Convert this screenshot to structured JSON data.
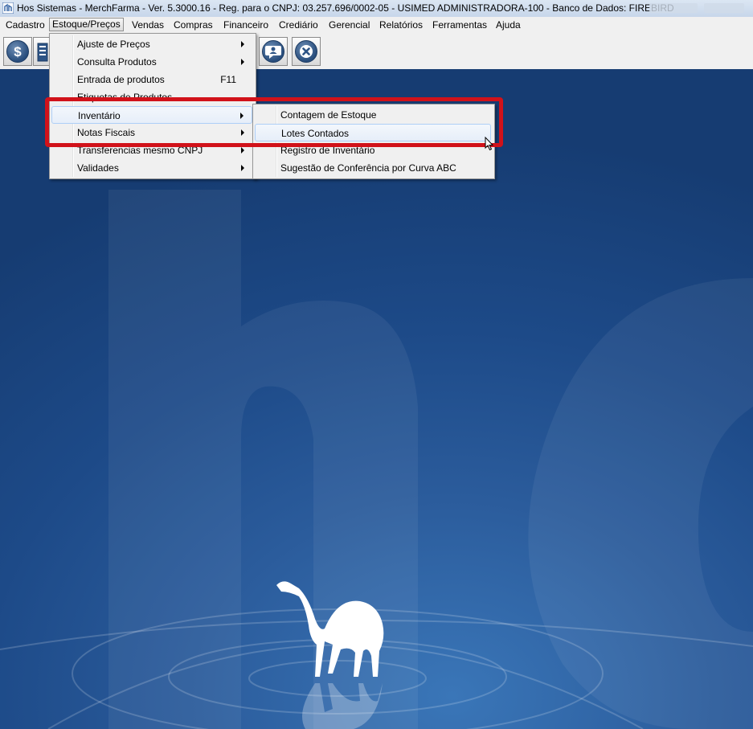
{
  "window": {
    "title": "Hos Sistemas - MerchFarma - Ver. 5.3000.16 - Reg. para o CNPJ: 03.257.696/0002-05 - USIMED ADMINISTRADORA-100 - Banco de Dados: FIREBIRD"
  },
  "menubar": {
    "items": [
      "Cadastro",
      "Estoque/Preços",
      "Vendas",
      "Compras",
      "Financeiro",
      "Crediário",
      "Gerencial",
      "Relatórios",
      "Ferramentas",
      "Ajuda"
    ]
  },
  "estoque_menu": {
    "items": [
      {
        "label": "Ajuste de Preços",
        "shortcut": ""
      },
      {
        "label": "Consulta Produtos",
        "shortcut": ""
      },
      {
        "label": "Entrada de produtos",
        "shortcut": "F11"
      },
      {
        "label": "Etiquetas de Produtos",
        "shortcut": ""
      },
      {
        "label": "Inventário",
        "shortcut": ""
      },
      {
        "label": "Notas Fiscais",
        "shortcut": ""
      },
      {
        "label": "Transferencias mesmo CNPJ",
        "shortcut": ""
      },
      {
        "label": "Validades",
        "shortcut": ""
      }
    ]
  },
  "inventario_submenu": {
    "items": [
      "Contagem de Estoque",
      "Lotes Contados",
      "Registro de Inventário",
      "Sugestão de Conferência por Curva ABC"
    ]
  },
  "colors": {
    "highlight_box": "#d1121a",
    "desktop_blue": "#1c4a86"
  }
}
